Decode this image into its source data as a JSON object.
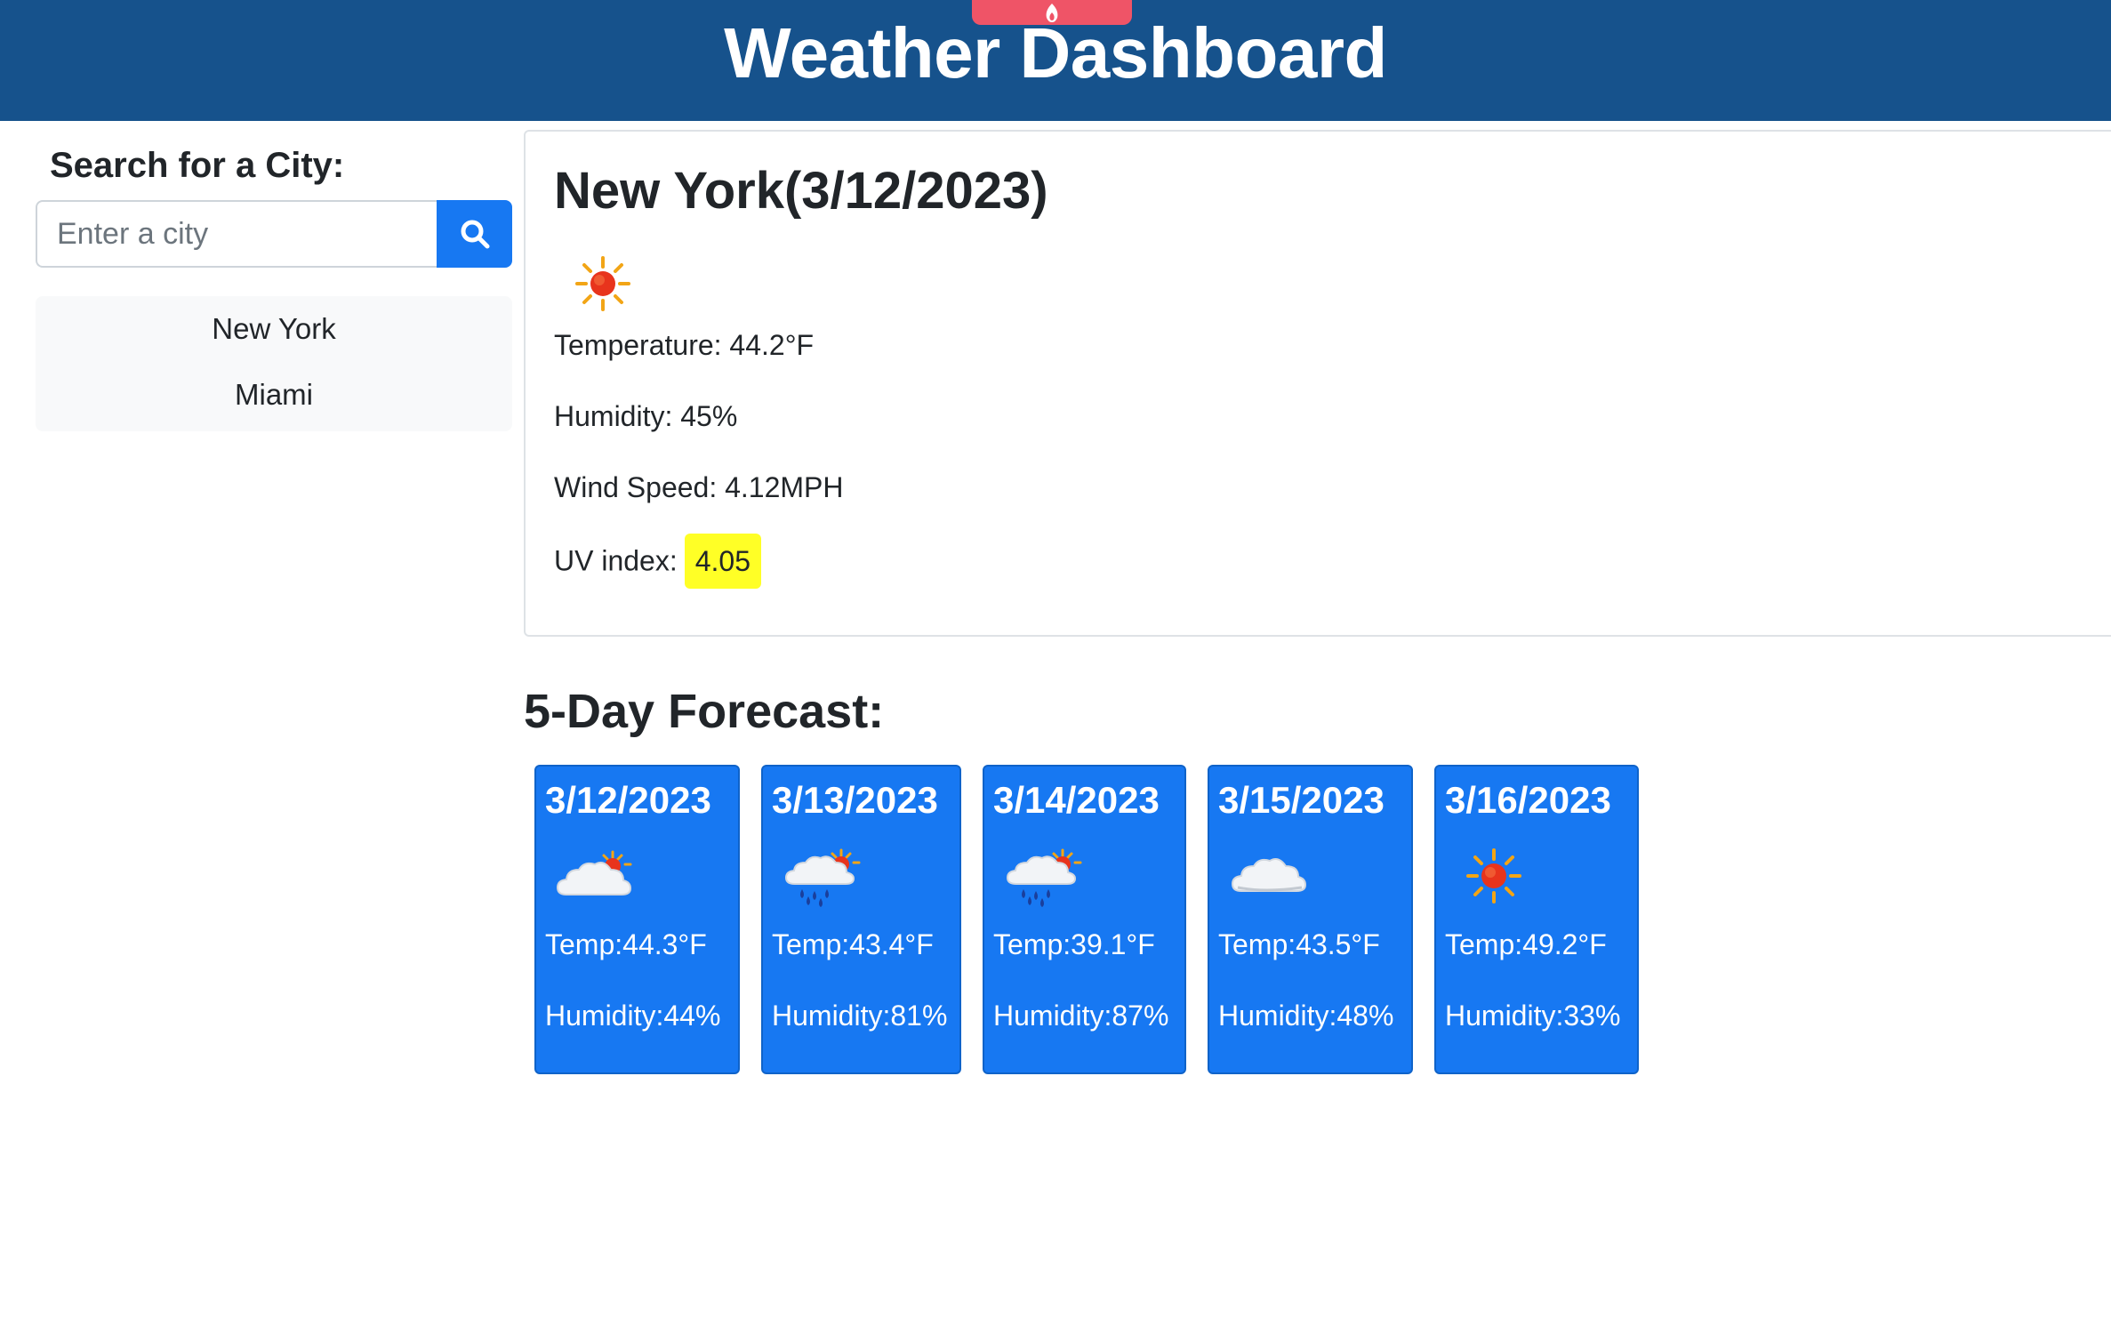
{
  "header": {
    "title": "Weather Dashboard"
  },
  "sidebar": {
    "search_label": "Search for a City:",
    "search_placeholder": "Enter a city",
    "search_value": "",
    "history": [
      "New York",
      "Miami"
    ]
  },
  "current": {
    "title": "New York(3/12/2023)",
    "icon": "sun-icon",
    "temperature": "Temperature: 44.2°F",
    "humidity": "Humidity: 45%",
    "wind": "Wind Speed: 4.12MPH",
    "uv_label": "UV index:",
    "uv_value": "4.05",
    "uv_color": "#ffff26"
  },
  "forecast": {
    "heading": "5-Day Forecast:",
    "days": [
      {
        "date": "3/12/2023",
        "icon": "partly-cloudy-icon",
        "temp": "Temp:44.3°F",
        "humidity": "Humidity:44%"
      },
      {
        "date": "3/13/2023",
        "icon": "rain-sun-icon",
        "temp": "Temp:43.4°F",
        "humidity": "Humidity:81%"
      },
      {
        "date": "3/14/2023",
        "icon": "rain-sun-icon",
        "temp": "Temp:39.1°F",
        "humidity": "Humidity:87%"
      },
      {
        "date": "3/15/2023",
        "icon": "cloud-icon",
        "temp": "Temp:43.5°F",
        "humidity": "Humidity:48%"
      },
      {
        "date": "3/16/2023",
        "icon": "sun-icon",
        "temp": "Temp:49.2°F",
        "humidity": "Humidity:33%"
      }
    ]
  },
  "colors": {
    "header_bg": "#16528c",
    "accent": "#1778f2",
    "top_tab": "#ef5467"
  }
}
